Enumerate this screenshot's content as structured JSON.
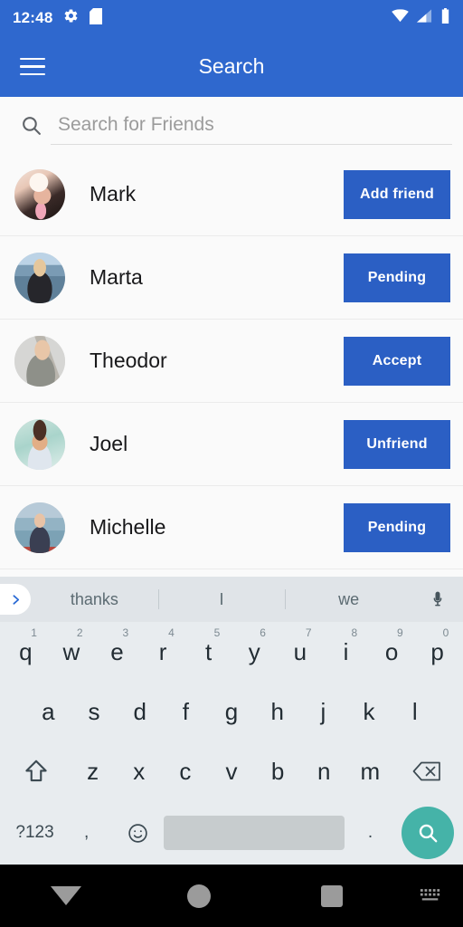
{
  "statusbar": {
    "time": "12:48",
    "icons_left": [
      "gear-icon",
      "sd-card-icon"
    ],
    "icons_right": [
      "wifi-icon",
      "cellular-signal-icon",
      "battery-icon"
    ]
  },
  "appbar": {
    "menu_icon": "hamburger-menu-icon",
    "title": "Search",
    "background": "#2f68ce"
  },
  "search": {
    "icon": "search-icon",
    "value": "",
    "placeholder": "Search for Friends"
  },
  "friends": [
    {
      "name": "Mark",
      "action": "Add friend",
      "avatar": "woman-with-hat-photo"
    },
    {
      "name": "Marta",
      "action": "Pending",
      "avatar": "woman-by-water-photo"
    },
    {
      "name": "Theodor",
      "action": "Accept",
      "avatar": "man-with-glasses-photo"
    },
    {
      "name": "Joel",
      "action": "Unfriend",
      "avatar": "smiling-man-photo"
    },
    {
      "name": "Michelle",
      "action": "Pending",
      "avatar": "woman-sunglasses-bridge-photo"
    }
  ],
  "keyboard": {
    "suggestions": [
      "thanks",
      "I",
      "we"
    ],
    "expand_icon": "chevron-right-icon",
    "mic_icon": "microphone-icon",
    "row1": [
      {
        "key": "q",
        "sup": "1"
      },
      {
        "key": "w",
        "sup": "2"
      },
      {
        "key": "e",
        "sup": "3"
      },
      {
        "key": "r",
        "sup": "4"
      },
      {
        "key": "t",
        "sup": "5"
      },
      {
        "key": "y",
        "sup": "6"
      },
      {
        "key": "u",
        "sup": "7"
      },
      {
        "key": "i",
        "sup": "8"
      },
      {
        "key": "o",
        "sup": "9"
      },
      {
        "key": "p",
        "sup": "0"
      }
    ],
    "row2": [
      "a",
      "s",
      "d",
      "f",
      "g",
      "h",
      "j",
      "k",
      "l"
    ],
    "row3": [
      "z",
      "x",
      "c",
      "v",
      "b",
      "n",
      "m"
    ],
    "shift_icon": "shift-up-arrow-icon",
    "backspace_icon": "backspace-delete-icon",
    "symbols_label": "?123",
    "comma_label": ",",
    "emoji_icon": "emoji-smiley-icon",
    "period_label": ".",
    "enter_icon": "search-submit-icon",
    "enter_color": "#45b3a8"
  },
  "navbar": {
    "back_icon": "hide-keyboard-down-triangle-icon",
    "home_icon": "home-circle-icon",
    "recents_icon": "recents-square-icon",
    "keyboard_indicator_icon": "keyboard-indicator-icon"
  },
  "colors": {
    "primary": "#2f68ce",
    "button": "#2b5fc4",
    "accent": "#45b3a8",
    "page_bg": "#fafafa"
  }
}
